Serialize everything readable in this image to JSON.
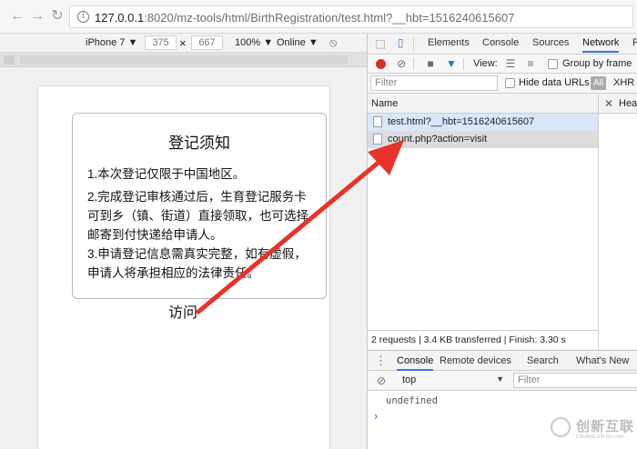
{
  "browser": {
    "url_host": "127.0.0.1",
    "url_path": ":8020/mz-tools/html/BirthRegistration/test.html?__hbt=1516240615607"
  },
  "device_toolbar": {
    "device": "iPhone 7 ▼",
    "width": "375",
    "times": "×",
    "height": "667",
    "zoom": "100% ▼",
    "network": "Online ▼"
  },
  "page": {
    "notice_title": "登记须知",
    "paragraphs": [
      "1.本次登记仅限于中国地区。",
      "2.完成登记审核通过后，生育登记服务卡可到乡（镇、街道）直接领取，也可选择邮寄到付快递给申请人。",
      "3.申请登记信息需真实完整，如有虚假，申请人将承担相应的法律责任。"
    ],
    "visit_link": "访问"
  },
  "devtools": {
    "tabs": [
      "Elements",
      "Console",
      "Sources",
      "Network",
      "P"
    ],
    "active_tab": "Network",
    "toolbar": {
      "view_label": "View:",
      "group_by_frame": "Group by frame"
    },
    "filter_bar": {
      "placeholder": "Filter",
      "hide_data_urls": "Hide data URLs",
      "all": "All",
      "xhr": "XHR"
    },
    "columns": {
      "name": "Name",
      "headers": "Head"
    },
    "requests": [
      "test.html?__hbt=1516240615607",
      "count.php?action=visit"
    ],
    "status": "2 requests | 3.4 KB transferred | Finish: 3.30 s",
    "drawer": {
      "tabs": [
        "Console",
        "Remote devices",
        "Search",
        "What's New"
      ],
      "context": "top",
      "filter_placeholder": "Filter",
      "output": "undefined",
      "prompt": "›"
    }
  },
  "watermark": {
    "text_cn": "创新互联",
    "text_en": "CHUANG XIN HU LIAN"
  },
  "colors": {
    "arrow": "#e8322a",
    "active_tab_underline": "#3879d9",
    "record_red": "#d93025",
    "filter_blue": "#1a73e8",
    "selected_row": "#dcdcdc",
    "highlight_row": "#d9e7fa"
  }
}
